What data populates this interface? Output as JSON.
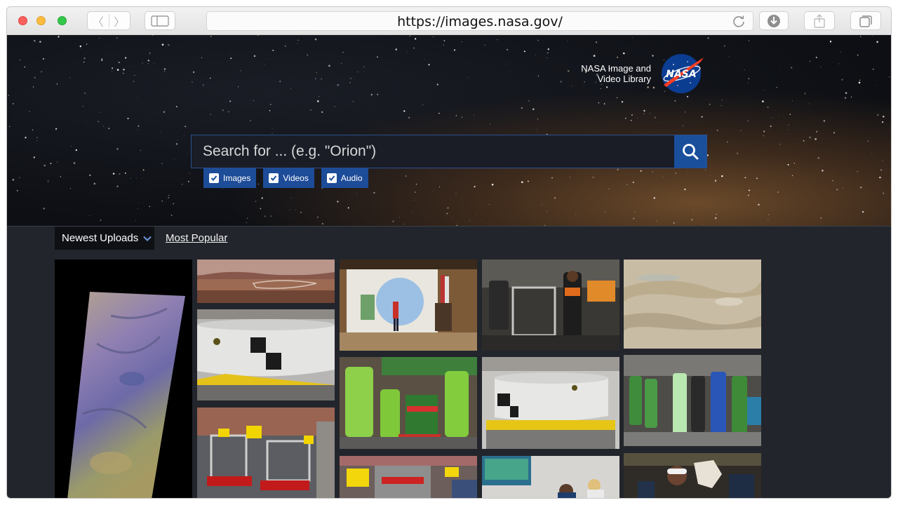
{
  "browser": {
    "url": "https://images.nasa.gov/",
    "back_glyph": "〈",
    "forward_glyph": "〉"
  },
  "header": {
    "brand_line1": "NASA Image and",
    "brand_line2": "Video Library",
    "logo_text": "NASA"
  },
  "search": {
    "placeholder": "Search for ... (e.g. \"Orion\")",
    "filters": [
      {
        "label": "Images",
        "checked": true
      },
      {
        "label": "Videos",
        "checked": true
      },
      {
        "label": "Audio",
        "checked": true
      }
    ]
  },
  "sort": {
    "active_label": "Newest Uploads",
    "other_label": "Most Popular"
  },
  "gallery": {
    "items": [
      {
        "subject": "mars-orbital-strip"
      },
      {
        "subject": "mars-landscape"
      },
      {
        "subject": "heat-shield-test-article"
      },
      {
        "subject": "robotics-competition-bots"
      },
      {
        "subject": "presentation-stage"
      },
      {
        "subject": "frc-team-7033"
      },
      {
        "subject": "robot-pit-area"
      },
      {
        "subject": "heat-shield-on-frame"
      },
      {
        "subject": "jupiter-clouds"
      },
      {
        "subject": "robotics-team-group"
      },
      {
        "subject": "robot-arena"
      },
      {
        "subject": "lab-screen"
      },
      {
        "subject": "crowd-costume"
      }
    ]
  },
  "colors": {
    "page_bg": "#22252b",
    "search_button": "#1a4f9c",
    "filter_bg": "#1d4c98",
    "nasa_blue": "#0b3d91",
    "nasa_red": "#fc3d21"
  }
}
